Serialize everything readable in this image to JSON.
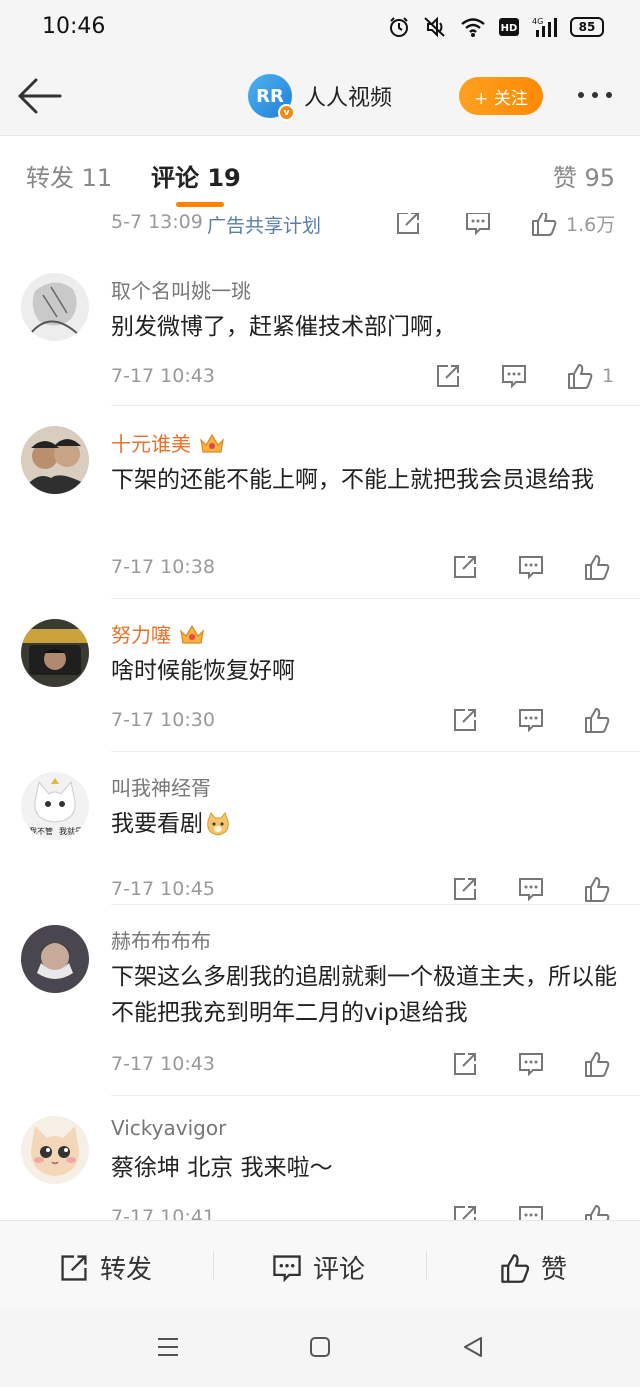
{
  "status": {
    "time": "10:46",
    "battery": "85"
  },
  "header": {
    "account_name": "人人视频",
    "logo_text": "RR",
    "verified_mark": "v",
    "follow_label": "+ 关注"
  },
  "tabs": [
    {
      "label": "转发 11"
    },
    {
      "label": "评论 19",
      "active": true
    },
    {
      "label": "赞 95"
    }
  ],
  "post_meta": {
    "time": "5-7 13:09",
    "link": "广告共享计划",
    "like_count": "1.6万"
  },
  "comments": [
    {
      "user": "取个名叫姚一珧",
      "vip": false,
      "text": "别发微博了，赶紧催技术部门啊，",
      "time": "7-17 10:43",
      "likes": "1"
    },
    {
      "user": "十元谁美",
      "vip": true,
      "text": "下架的还能不能上啊，不能上就把我会员退给我",
      "time": "7-17 10:38",
      "likes": ""
    },
    {
      "user": "努力噻",
      "vip": true,
      "text": "啥时候能恢复好啊",
      "time": "7-17 10:30",
      "likes": ""
    },
    {
      "user": "叫我神经胥",
      "vip": false,
      "text": "我要看剧",
      "time": "7-17 10:45",
      "likes": ""
    },
    {
      "user": "赫布布布布",
      "vip": false,
      "text": "下架这么多剧我的追剧就剩一个极道主夫，所以能不能把我充到明年二月的vip退给我",
      "time": "7-17 10:43",
      "likes": ""
    },
    {
      "user": "Vickyavigor",
      "vip": false,
      "text": "蔡徐坤 北京 我来啦～",
      "time": "7-17 10:41",
      "likes": ""
    }
  ],
  "avatar_captions": {
    "cat_left": "我不管",
    "cat_right": "我就是"
  },
  "bottom_bar": {
    "repost": "转发",
    "comment": "评论",
    "like": "赞"
  },
  "colors": {
    "accent": "#ff8200",
    "vip_name": "#e8722c",
    "link": "#5b7ea8"
  }
}
